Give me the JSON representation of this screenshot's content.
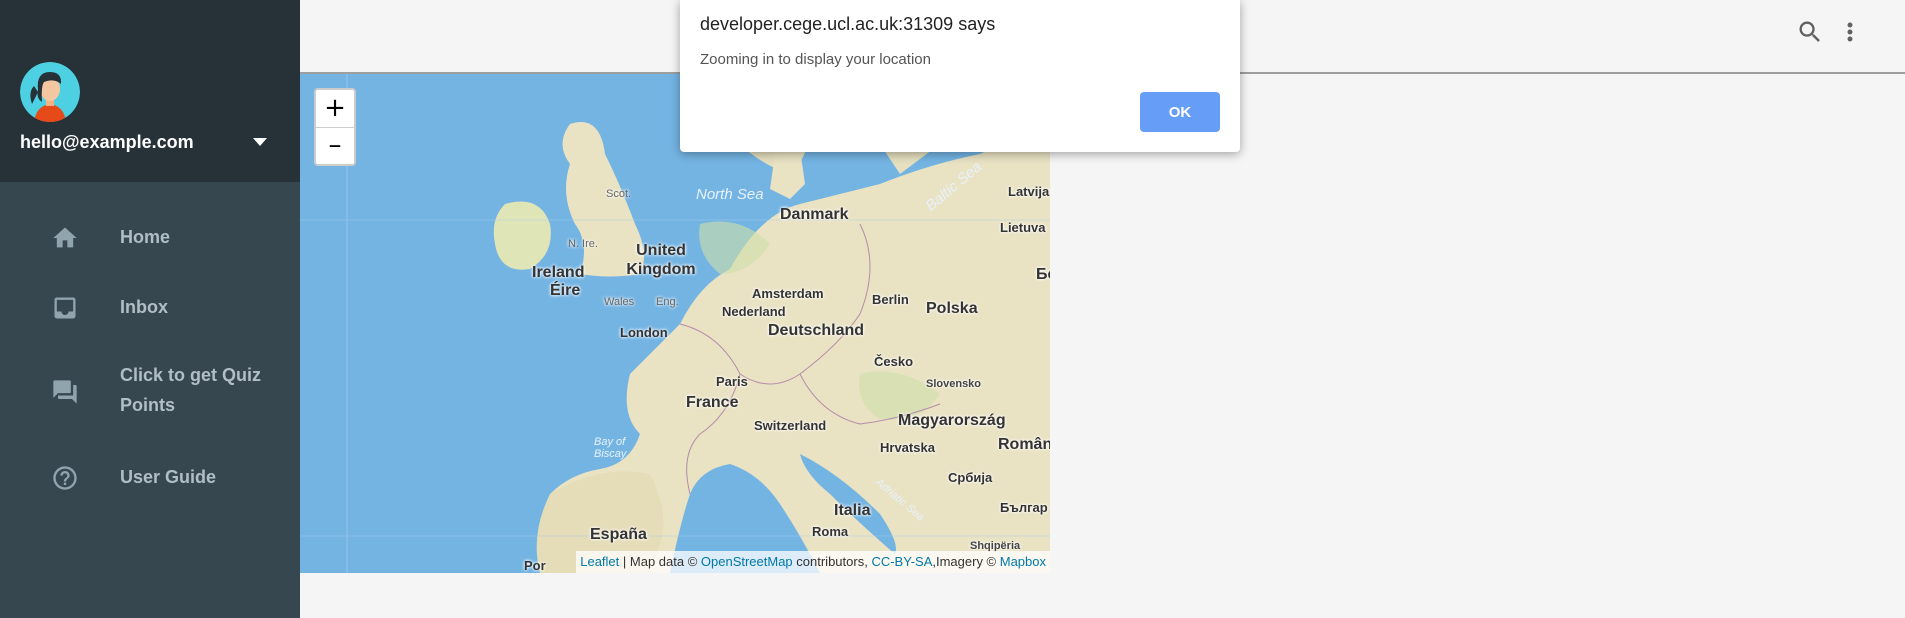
{
  "sidebar": {
    "user_email": "hello@example.com",
    "items": [
      {
        "label": "Home",
        "icon": "home-icon"
      },
      {
        "label": "Inbox",
        "icon": "inbox-icon"
      },
      {
        "label": "Click to get Quiz Points",
        "icon": "forum-icon"
      },
      {
        "label": "User Guide",
        "icon": "help-circle-icon"
      }
    ]
  },
  "topbar": {
    "icons": [
      "search-icon",
      "more-vertical-icon"
    ]
  },
  "map": {
    "zoom_in": "+",
    "zoom_out": "–",
    "labels": {
      "north_sea": "North Sea",
      "baltic_sea": "Baltic Sea",
      "bay_of_biscay": "Bay of Biscay",
      "adriatic_sea": "Adriatic Sea",
      "danmark": "Danmark",
      "latvija": "Latvija",
      "lietuva": "Lietuva",
      "united_kingdom": "United Kingdom",
      "ireland": "Ireland",
      "eire": "Éire",
      "scot": "Scot.",
      "nire": "N. Ire.",
      "wales": "Wales",
      "eng": "Eng.",
      "london": "London",
      "amsterdam": "Amsterdam",
      "nederland": "Nederland",
      "berlin": "Berlin",
      "polska": "Polska",
      "deutschland": "Deutschland",
      "cesko": "Česko",
      "slovensko": "Slovensko",
      "paris": "Paris",
      "france": "France",
      "switzerland": "Switzerland",
      "magyarorszag": "Magyarország",
      "roman": "Român",
      "hrvatska": "Hrvatska",
      "srbija": "Србија",
      "bulgar": "Българ",
      "italia": "Italia",
      "roma": "Roma",
      "espana": "España",
      "shqiperia": "Shqipëria",
      "por": "Por",
      "be": "Бе"
    },
    "attribution": {
      "leaflet": "Leaflet",
      "sep": " | Map data © ",
      "osm": "OpenStreetMap",
      "contributors": " contributors, ",
      "ccbysa": "CC-BY-SA",
      "imagery": ",Imagery © ",
      "mapbox": "Mapbox"
    }
  },
  "dialog": {
    "title": "developer.cege.ucl.ac.uk:31309 says",
    "message": "Zooming in to display your location",
    "ok_label": "OK"
  },
  "colors": {
    "sidebar_header": "#263238",
    "sidebar_body": "#37474f",
    "sea": "#74b4e3",
    "land": "#e9e2c3",
    "ok_button": "#669df6"
  }
}
